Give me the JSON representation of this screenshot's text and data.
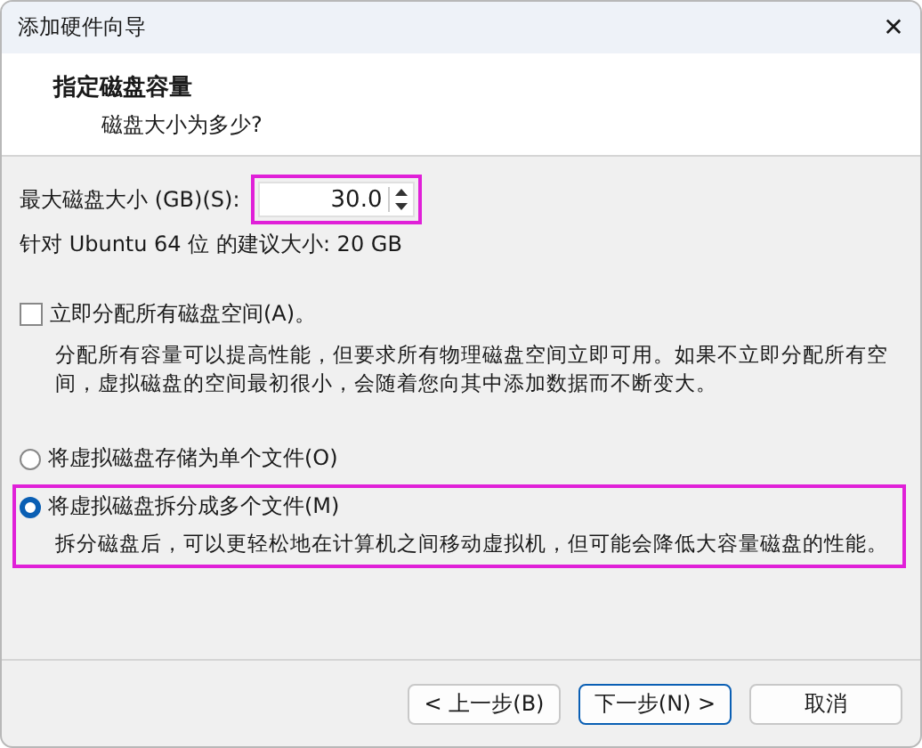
{
  "window": {
    "title": "添加硬件向导",
    "close": "✕"
  },
  "header": {
    "title": "指定磁盘容量",
    "subtitle": "磁盘大小为多少?"
  },
  "disk_size": {
    "label": "最大磁盘大小 (GB)(S):",
    "value": "30.0",
    "highlighted": true
  },
  "recommendation": "针对 Ubuntu 64 位 的建议大小: 20 GB",
  "allocate": {
    "label": "立即分配所有磁盘空间(A)。",
    "checked": false,
    "description": "分配所有容量可以提高性能，但要求所有物理磁盘空间立即可用。如果不立即分配所有空间，虚拟磁盘的空间最初很小，会随着您向其中添加数据而不断变大。"
  },
  "storage_options": [
    {
      "label": "将虚拟磁盘存储为单个文件(O)",
      "selected": false,
      "highlighted": false
    },
    {
      "label": "将虚拟磁盘拆分成多个文件(M)",
      "selected": true,
      "highlighted": true,
      "description": "拆分磁盘后，可以更轻松地在计算机之间移动虚拟机，但可能会降低大容量磁盘的性能。"
    }
  ],
  "buttons": [
    {
      "label": "< 上一步(B)",
      "default": false
    },
    {
      "label": "下一步(N) >",
      "default": true
    },
    {
      "label": "取消",
      "default": false
    }
  ]
}
